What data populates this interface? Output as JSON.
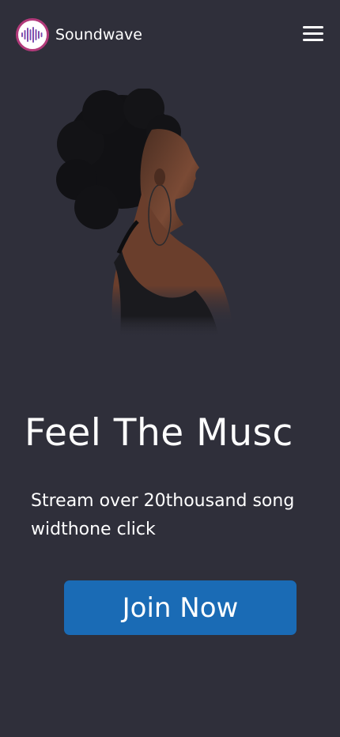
{
  "header": {
    "brand": "Soundwave",
    "logo_icon": "soundwave-logo-icon",
    "menu_icon": "hamburger-menu-icon"
  },
  "hero": {
    "image": "woman-listening-music-photo",
    "title": "Feel The Musc",
    "subtitle": "Stream over 20thousand song widthone click",
    "cta_label": "Join Now"
  },
  "colors": {
    "background": "#2f2f3a",
    "button": "#1a6bb5",
    "logo_ring": "#b23a7a",
    "text": "#ffffff"
  }
}
